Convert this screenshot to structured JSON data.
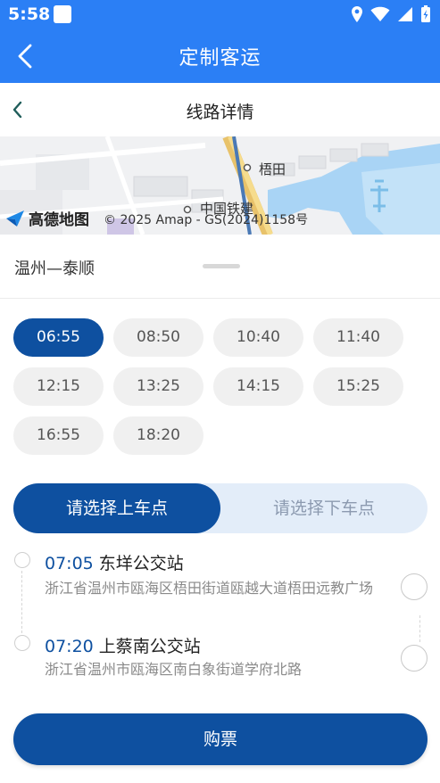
{
  "status_bar": {
    "time": "5:58"
  },
  "app_bar": {
    "title": "定制客运"
  },
  "subheader": {
    "title": "线路详情"
  },
  "map": {
    "logo_text": "高德地图",
    "attribution": "© 2025 Amap - GS(2024)1158号",
    "labels": [
      "梧田",
      "中国铁建"
    ]
  },
  "route": {
    "name": "温州—泰顺"
  },
  "times": [
    "06:55",
    "08:50",
    "10:40",
    "11:40",
    "12:15",
    "13:25",
    "14:15",
    "15:25",
    "16:55",
    "18:20"
  ],
  "selected_time": "06:55",
  "tabs": {
    "boarding": "请选择上车点",
    "alighting": "请选择下车点"
  },
  "stops": [
    {
      "time": "07:05",
      "name": "东垟公交站",
      "address": "浙江省温州市瓯海区梧田街道瓯越大道梧田远教广场"
    },
    {
      "time": "07:20",
      "name": "上蔡南公交站",
      "address": "浙江省温州市瓯海区南白象街道学府北路"
    }
  ],
  "buy_button": {
    "label": "购票"
  },
  "colors": {
    "primary": "#2b7ff5",
    "accent": "#0e50a0",
    "chip_bg": "#f0f0f0",
    "tab_bg": "#e3edf9"
  }
}
